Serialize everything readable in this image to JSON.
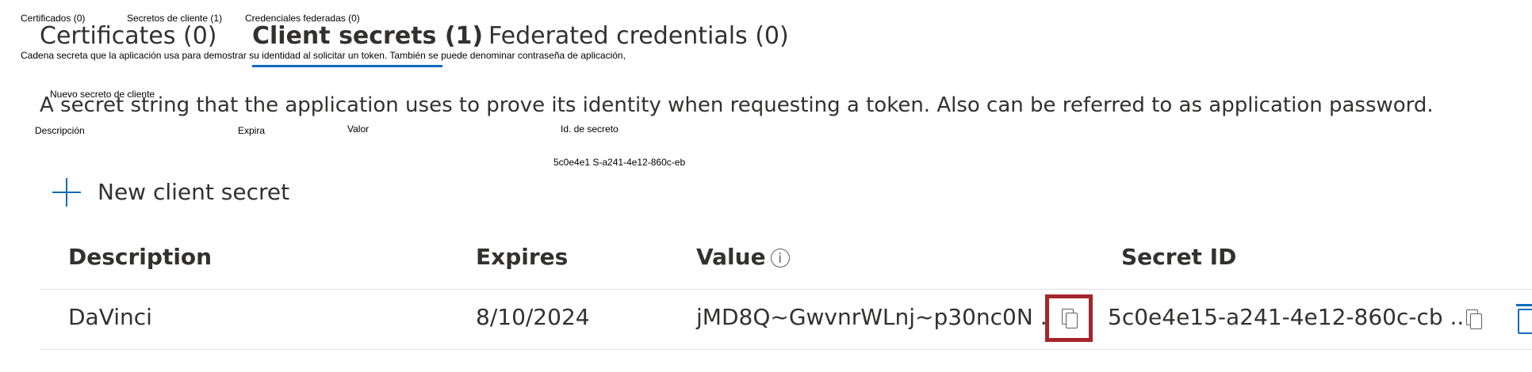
{
  "annotations": {
    "tab_certificates_es": "Certificados (0)",
    "tab_secrets_es": "Secretos de cliente (1)",
    "tab_federated_es": "Credenciales federadas (0)",
    "desc_es": "Cadena secreta que la aplicación usa para demostrar su identidad al solicitar un token. También se puede denominar contraseña de aplicación,",
    "new_secret_es": "Nuevo secreto de cliente",
    "col_description_es": "Descripción",
    "col_expires_es": "Expira",
    "col_value_es": "Valor",
    "col_secret_id_es": "Id. de secreto",
    "secret_id_es": "5c0e4e1 S-a241-4e12-860c-eb"
  },
  "tabs": [
    {
      "label": "Certificates (0)",
      "active": false
    },
    {
      "label": "Client secrets (1)",
      "active": true
    },
    {
      "label": "Federated credentials (0)",
      "active": false
    }
  ],
  "description": "A secret string that the application uses to prove its identity when requesting a token. Also can be referred to as application password.",
  "new_secret_label": "New client secret",
  "table": {
    "columns": [
      "Description",
      "Expires",
      "Value",
      "Secret ID"
    ],
    "value_info_icon": "i",
    "rows": [
      {
        "description": "DaVinci",
        "expires": "8/10/2024",
        "value": "jMD8Q~GwvnrWLnj~p30nc0N ...",
        "secret_id": "5c0e4e15-a241-4e12-860c-cb ..."
      }
    ]
  },
  "icons": {
    "new_secret": "plus-icon",
    "value_info": "info-icon",
    "copy_value": "copy-icon",
    "copy_id": "copy-icon",
    "delete": "trash-icon"
  },
  "colors": {
    "accent": "#0f6cbd",
    "highlight": "#a4262c"
  }
}
